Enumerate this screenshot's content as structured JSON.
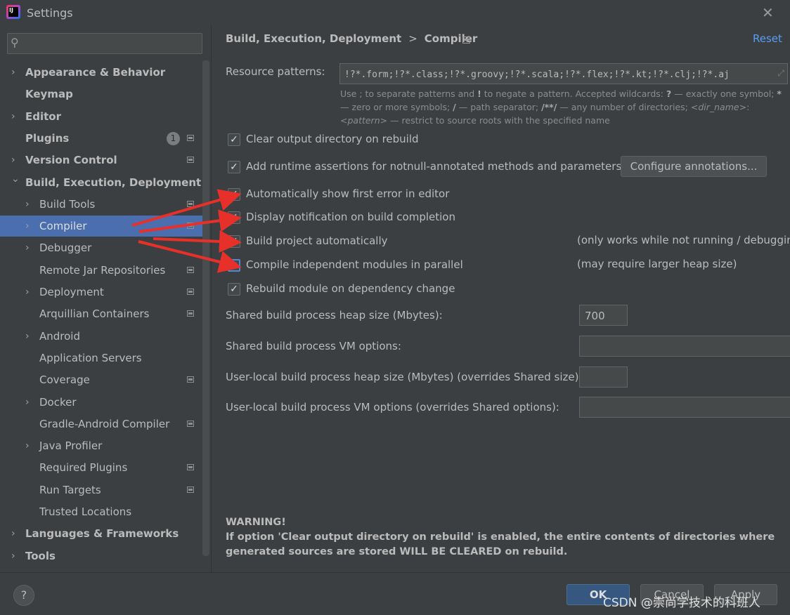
{
  "window": {
    "title": "Settings"
  },
  "sidebar": {
    "search": {
      "placeholder": "",
      "value": ""
    },
    "items": [
      {
        "label": "Appearance & Behavior",
        "bold": true,
        "level": 0,
        "arrow": true
      },
      {
        "label": "Keymap",
        "bold": true,
        "level": 0,
        "arrow": false
      },
      {
        "label": "Editor",
        "bold": true,
        "level": 0,
        "arrow": true
      },
      {
        "label": "Plugins",
        "bold": true,
        "level": 0,
        "arrow": false,
        "badge": "1",
        "proj": true
      },
      {
        "label": "Version Control",
        "bold": true,
        "level": 0,
        "arrow": true,
        "proj": true
      },
      {
        "label": "Build, Execution, Deployment",
        "bold": true,
        "level": 0,
        "arrow": true,
        "expanded": true
      },
      {
        "label": "Build Tools",
        "level": 1,
        "arrow": true,
        "proj": true
      },
      {
        "label": "Compiler",
        "level": 1,
        "arrow": true,
        "proj": true,
        "selected": true
      },
      {
        "label": "Debugger",
        "level": 1,
        "arrow": true
      },
      {
        "label": "Remote Jar Repositories",
        "level": 1,
        "arrow": false,
        "proj": true
      },
      {
        "label": "Deployment",
        "level": 1,
        "arrow": true,
        "proj": true
      },
      {
        "label": "Arquillian Containers",
        "level": 1,
        "arrow": false,
        "proj": true
      },
      {
        "label": "Android",
        "level": 1,
        "arrow": true
      },
      {
        "label": "Application Servers",
        "level": 1,
        "arrow": false
      },
      {
        "label": "Coverage",
        "level": 1,
        "arrow": false,
        "proj": true
      },
      {
        "label": "Docker",
        "level": 1,
        "arrow": true
      },
      {
        "label": "Gradle-Android Compiler",
        "level": 1,
        "arrow": false,
        "proj": true
      },
      {
        "label": "Java Profiler",
        "level": 1,
        "arrow": true
      },
      {
        "label": "Required Plugins",
        "level": 1,
        "arrow": false,
        "proj": true
      },
      {
        "label": "Run Targets",
        "level": 1,
        "arrow": false,
        "proj": true
      },
      {
        "label": "Trusted Locations",
        "level": 1,
        "arrow": false
      },
      {
        "label": "Languages & Frameworks",
        "bold": true,
        "level": 0,
        "arrow": true
      },
      {
        "label": "Tools",
        "bold": true,
        "level": 0,
        "arrow": true
      }
    ]
  },
  "header": {
    "breadcrumb_parent": "Build, Execution, Deployment",
    "breadcrumb_sep": ">",
    "breadcrumb_current": "Compiler",
    "reset_label": "Reset"
  },
  "compiler": {
    "resource_patterns_label": "Resource patterns:",
    "resource_patterns_value": "!?*.form;!?*.class;!?*.groovy;!?*.scala;!?*.flex;!?*.kt;!?*.clj;!?*.aj",
    "hint": {
      "p1": "Use ; to separate patterns and ",
      "b1": "!",
      "p2": " to negate a pattern. Accepted wildcards: ",
      "b2": "?",
      "p3": " — exactly one symbol; ",
      "b3": "*",
      "p4": " — zero or more symbols; ",
      "b4": "/",
      "p5": " — path separator; ",
      "b5": "/**/",
      "p6": " — any number of directories; ",
      "i1": "<dir_name>",
      "p7": ":",
      "i2": "<pattern>",
      "p8": " — restrict to source roots with the specified name"
    },
    "options": {
      "clear_output": "Clear output directory on rebuild",
      "add_assertions": "Add runtime assertions for notnull-annotated methods and parameters",
      "configure_annotations": "Configure annotations...",
      "show_first_error": "Automatically show first error in editor",
      "display_notification": "Display notification on build completion",
      "build_auto": "Build project automatically",
      "build_auto_note": "(only works while not running / debugging)",
      "compile_parallel": "Compile independent modules in parallel",
      "compile_parallel_note": "(may require larger heap size)",
      "rebuild_on_change": "Rebuild module on dependency change"
    },
    "checked": {
      "clear_output": true,
      "add_assertions": true,
      "show_first_error": true,
      "display_notification": true,
      "build_auto": true,
      "compile_parallel": true,
      "rebuild_on_change": true
    },
    "shared_heap_label": "Shared build process heap size (Mbytes):",
    "shared_heap_value": "700",
    "shared_vm_label": "Shared build process VM options:",
    "shared_vm_value": "",
    "local_heap_label": "User-local build process heap size (Mbytes) (overrides Shared size):",
    "local_heap_value": "",
    "local_vm_label": "User-local build process VM options (overrides Shared options):",
    "local_vm_value": ""
  },
  "warning": {
    "title": "WARNING!",
    "text": "If option 'Clear output directory on rebuild' is enabled, the entire contents of directories where generated sources are stored WILL BE CLEARED on rebuild."
  },
  "footer": {
    "help": "?",
    "ok": "OK",
    "cancel": "Cancel",
    "apply": "Apply",
    "watermark": "CSDN @崇尚学技术的科班人"
  },
  "colors": {
    "selection": "#4b6eaf",
    "link": "#589df6",
    "arrow": "#e8302a",
    "primary_button": "#365880"
  },
  "icons": [
    "app-logo-icon",
    "close-icon",
    "search-icon",
    "project-scope-icon",
    "expand-field-icon",
    "help-icon",
    "checkmark-icon"
  ]
}
